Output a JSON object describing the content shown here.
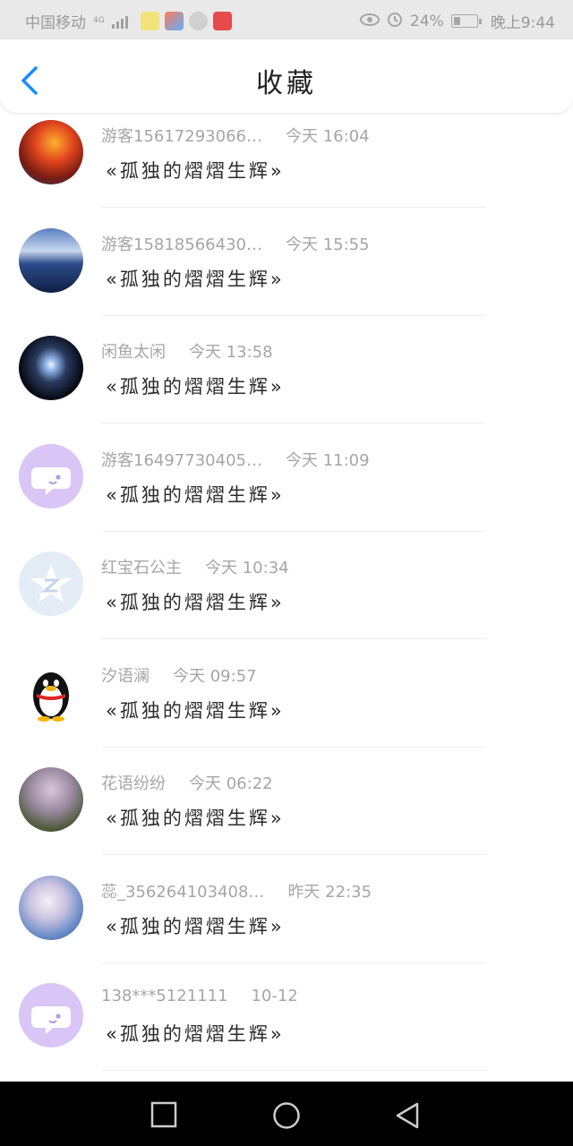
{
  "status_bar": {
    "carrier": "中国移动",
    "net": "4G",
    "battery": "24%",
    "time": "晚上9:44"
  },
  "header": {
    "title": "收藏"
  },
  "items": [
    {
      "user": "游客15617293066…",
      "time": "今天 16:04",
      "text": "«孤独的熠熠生辉»",
      "avatar": "phoenix-avatar"
    },
    {
      "user": "游客15818566430…",
      "time": "今天 15:55",
      "text": "«孤独的熠熠生辉»",
      "avatar": "mountain-lake-avatar"
    },
    {
      "user": "闲鱼太闲",
      "time": "今天 13:58",
      "text": "«孤独的熠熠生辉»",
      "avatar": "galaxy-avatar"
    },
    {
      "user": "游客16497730405…",
      "time": "今天 11:09",
      "text": "«孤独的熠熠生辉»",
      "avatar": "default-chat-avatar"
    },
    {
      "user": "红宝石公主",
      "time": "今天 10:34",
      "text": "«孤独的熠熠生辉»",
      "avatar": "star-badge-avatar"
    },
    {
      "user": "汐语澜",
      "time": "今天 09:57",
      "text": "«孤独的熠熠生辉»",
      "avatar": "penguin-avatar"
    },
    {
      "user": "花语纷纷",
      "time": "今天 06:22",
      "text": "«孤独的熠熠生辉»",
      "avatar": "blossom-tree-avatar"
    },
    {
      "user": "蕊_356264103408…",
      "time": "昨天 22:35",
      "text": "«孤独的熠熠生辉»",
      "avatar": "anime-character-avatar"
    },
    {
      "user": "138***5121111",
      "time": "10-12",
      "text": "«孤独的熠熠生辉»",
      "avatar": "default-chat-avatar"
    }
  ],
  "colors": {
    "accent": "#1a8cff",
    "meta_text": "#a6a6a6",
    "default_avatar": "#d9c6f7"
  }
}
